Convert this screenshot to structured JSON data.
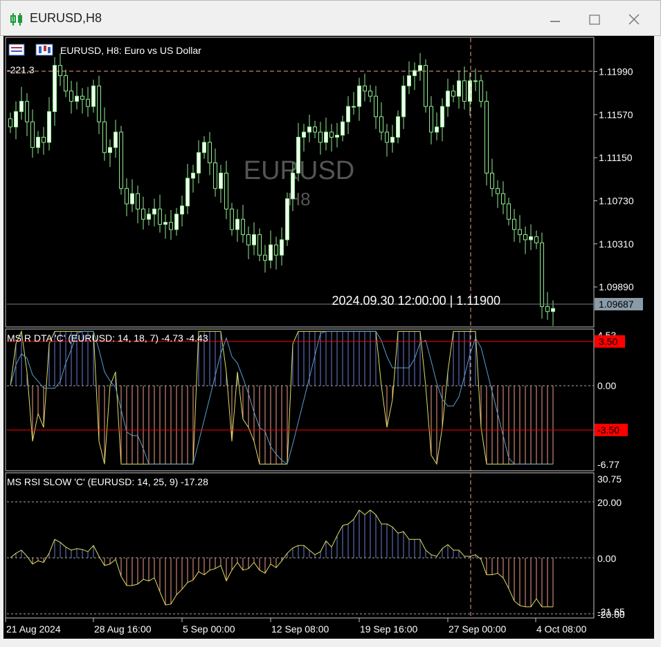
{
  "window": {
    "title": "EURUSD,H8",
    "icon": "candlestick-icon",
    "controls": [
      "minimize-icon",
      "maximize-icon",
      "close-icon"
    ]
  },
  "main_chart": {
    "header": "EURUSD, H8:  Euro vs US Dollar",
    "watermark_symbol": "EURUSD",
    "watermark_tf": "H8",
    "left_level_label": "-221.3",
    "crosshair_label": "2024.09.30 12:00:00 | 1.11900",
    "current_price": "1.09687",
    "price_ticks": [
      "1.11990",
      "1.11570",
      "1.11150",
      "1.10730",
      "1.10310",
      "1.09890"
    ]
  },
  "indicator1": {
    "label": "MS R DTA 'C' (EURUSD: 14, 18, 7) -4.73 -4.43",
    "ticks": [
      "4.53",
      "0.00",
      "-6.77"
    ],
    "upper_level": "3.50",
    "lower_level": "-3.50"
  },
  "indicator2": {
    "label": "MS RSI SLOW 'C' (EURUSD: 14, 25, 9) -17.28",
    "ticks": [
      "30.75",
      "20.00",
      "0.00"
    ],
    "bottom_ticks": [
      "-21.65",
      "-20.00"
    ]
  },
  "time_axis": [
    "21 Aug 2024",
    "28 Aug 16:00",
    "5 Sep 00:00",
    "12 Sep 08:00",
    "19 Sep 16:00",
    "27 Sep 00:00",
    "4 Oct 08:00"
  ],
  "colors": {
    "bull": "#90ee90",
    "bull_body": "#f0fff0",
    "bear": "#90ee90",
    "grid_red": "#ff0000",
    "hist_pos": "#6b7fd6",
    "hist_neg": "#f4a08a",
    "signal_line": "#e0e060",
    "ma_line": "#5aa0d0",
    "crosshair": "#f4a08a"
  },
  "chart_data": {
    "type": "candlestick",
    "closes": [
      1.1145,
      1.116,
      1.117,
      1.115,
      1.1125,
      1.1135,
      1.113,
      1.116,
      1.1205,
      1.1195,
      1.118,
      1.117,
      1.1175,
      1.1172,
      1.1165,
      1.1185,
      1.115,
      1.112,
      1.1125,
      1.114,
      1.1085,
      1.107,
      1.108,
      1.1065,
      1.1055,
      1.106,
      1.1065,
      1.105,
      1.1052,
      1.1045,
      1.106,
      1.1068,
      1.1095,
      1.11,
      1.112,
      1.113,
      1.111,
      1.1085,
      1.11,
      1.1065,
      1.1045,
      1.1055,
      1.104,
      1.103,
      1.104,
      1.102,
      1.1015,
      1.103,
      1.102,
      1.1035,
      1.1075,
      1.11,
      1.1135,
      1.114,
      1.1145,
      1.114,
      1.113,
      1.114,
      1.1135,
      1.1137,
      1.115,
      1.1165,
      1.1165,
      1.1185,
      1.118,
      1.1175,
      1.1155,
      1.114,
      1.113,
      1.1135,
      1.1155,
      1.1185,
      1.1195,
      1.12,
      1.1205,
      1.1165,
      1.114,
      1.1145,
      1.1165,
      1.118,
      1.1175,
      1.119,
      1.117,
      1.119,
      1.119,
      1.117,
      1.11,
      1.1085,
      1.108,
      1.107,
      1.1055,
      1.1045,
      1.104,
      1.1035,
      1.1038,
      1.1032,
      1.097,
      1.0965,
      1.0968
    ]
  }
}
